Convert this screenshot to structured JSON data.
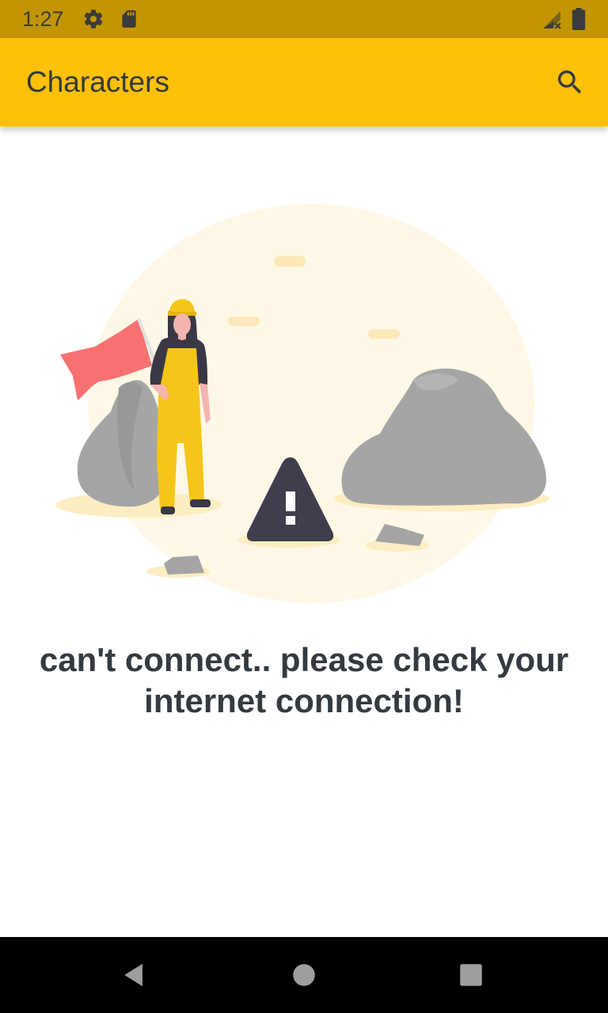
{
  "status_bar": {
    "time": "1:27",
    "icons": [
      "settings-gear-icon",
      "sd-card-icon",
      "signal-no-data-icon",
      "battery-icon"
    ]
  },
  "app_bar": {
    "title": "Characters",
    "search_icon": "search-icon"
  },
  "content": {
    "illustration": "connection-error-illustration",
    "message": "can't connect.. please check your internet connection!"
  },
  "nav_bar": {
    "buttons": [
      "back-icon",
      "home-icon",
      "recents-icon"
    ]
  },
  "colors": {
    "status_bar": "#c29500",
    "app_bar": "#ffc107",
    "text": "#343a40",
    "nav_bar": "#000000"
  }
}
